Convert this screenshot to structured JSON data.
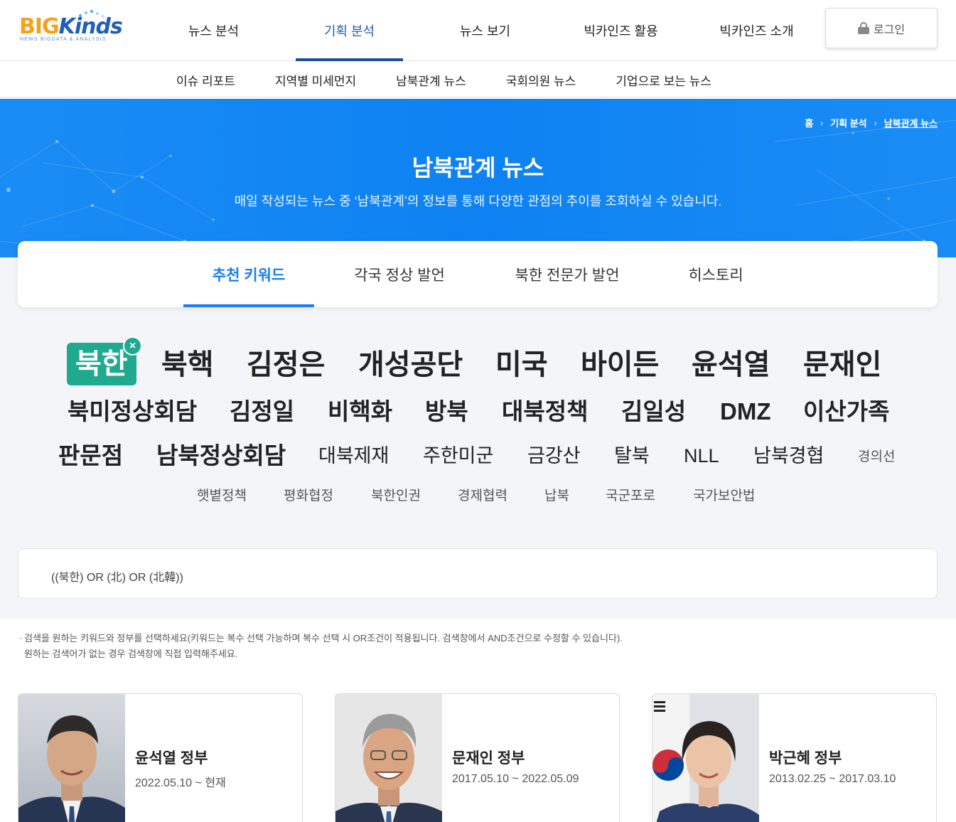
{
  "logo": {
    "big": "BIG",
    "kinds": "Kinds",
    "tagline": "NEWS BIGDATA & ANALYSIS"
  },
  "gnb": [
    "뉴스 분석",
    "기획 분석",
    "뉴스 보기",
    "빅카인즈 활용",
    "빅카인즈 소개"
  ],
  "gnb_active": "기획 분석",
  "login": {
    "label": "로그인",
    "icon": "lock-icon"
  },
  "subnav": [
    "이슈 리포트",
    "지역별 미세먼지",
    "남북관계 뉴스",
    "국회의원 뉴스",
    "기업으로 보는 뉴스"
  ],
  "breadcrumb": {
    "home": "홈",
    "level1": "기획 분석",
    "current": "남북관계 뉴스",
    "separator": "›"
  },
  "banner": {
    "title": "남북관계 뉴스",
    "description": "매일 작성되는 뉴스 중 ‘남북관계’의 정보를 통해 다양한 관점의 추이를 조회하실 수 있습니다."
  },
  "tabs": [
    "추천 키워드",
    "각국 정상 발언",
    "북한 전문가 발언",
    "히스토리"
  ],
  "keywords": {
    "selected": "북한",
    "row1": [
      "북핵",
      "김정은",
      "개성공단",
      "미국",
      "바이든",
      "윤석열",
      "문재인"
    ],
    "row2": [
      "북미정상회담",
      "김정일",
      "비핵화",
      "방북",
      "대북정책",
      "김일성",
      "DMZ",
      "이산가족"
    ],
    "row3_large": [
      "판문점",
      "남북정상회담"
    ],
    "row3_medium": [
      "대북제재",
      "주한미군",
      "금강산",
      "탈북",
      "NLL",
      "남북경협"
    ],
    "row3_small": [
      "경의선"
    ],
    "row4": [
      "햇볕정책",
      "평화협정",
      "북한인권",
      "경제협력",
      "납북",
      "국군포로",
      "국가보안법"
    ]
  },
  "query": "((북한) OR (北) OR (北韓))",
  "notice": {
    "bullet": "ㆍ",
    "line1": "검색을 원하는 키워드와 정부를 선택하세요(키워드는 복수 선택 가능하며 복수 선택 시 OR조건이 적용됩니다. 검색창에서 AND조건으로 수정할 수 있습니다).",
    "line2": "원하는 검색어가 없는 경우 검색창에 직접 입력해주세요."
  },
  "governments": [
    {
      "name": "윤석열 정부",
      "period": "2022.05.10 ~ 현재"
    },
    {
      "name": "문재인 정부",
      "period": "2017.05.10 ~ 2022.05.09"
    },
    {
      "name": "박근혜 정부",
      "period": "2013.02.25 ~ 2017.03.10"
    }
  ],
  "colors": {
    "accent": "#1c7ef0",
    "banner": "#0e82f2",
    "selected_keyword": "#1fa98f",
    "nav_active": "#1c5fb0"
  }
}
